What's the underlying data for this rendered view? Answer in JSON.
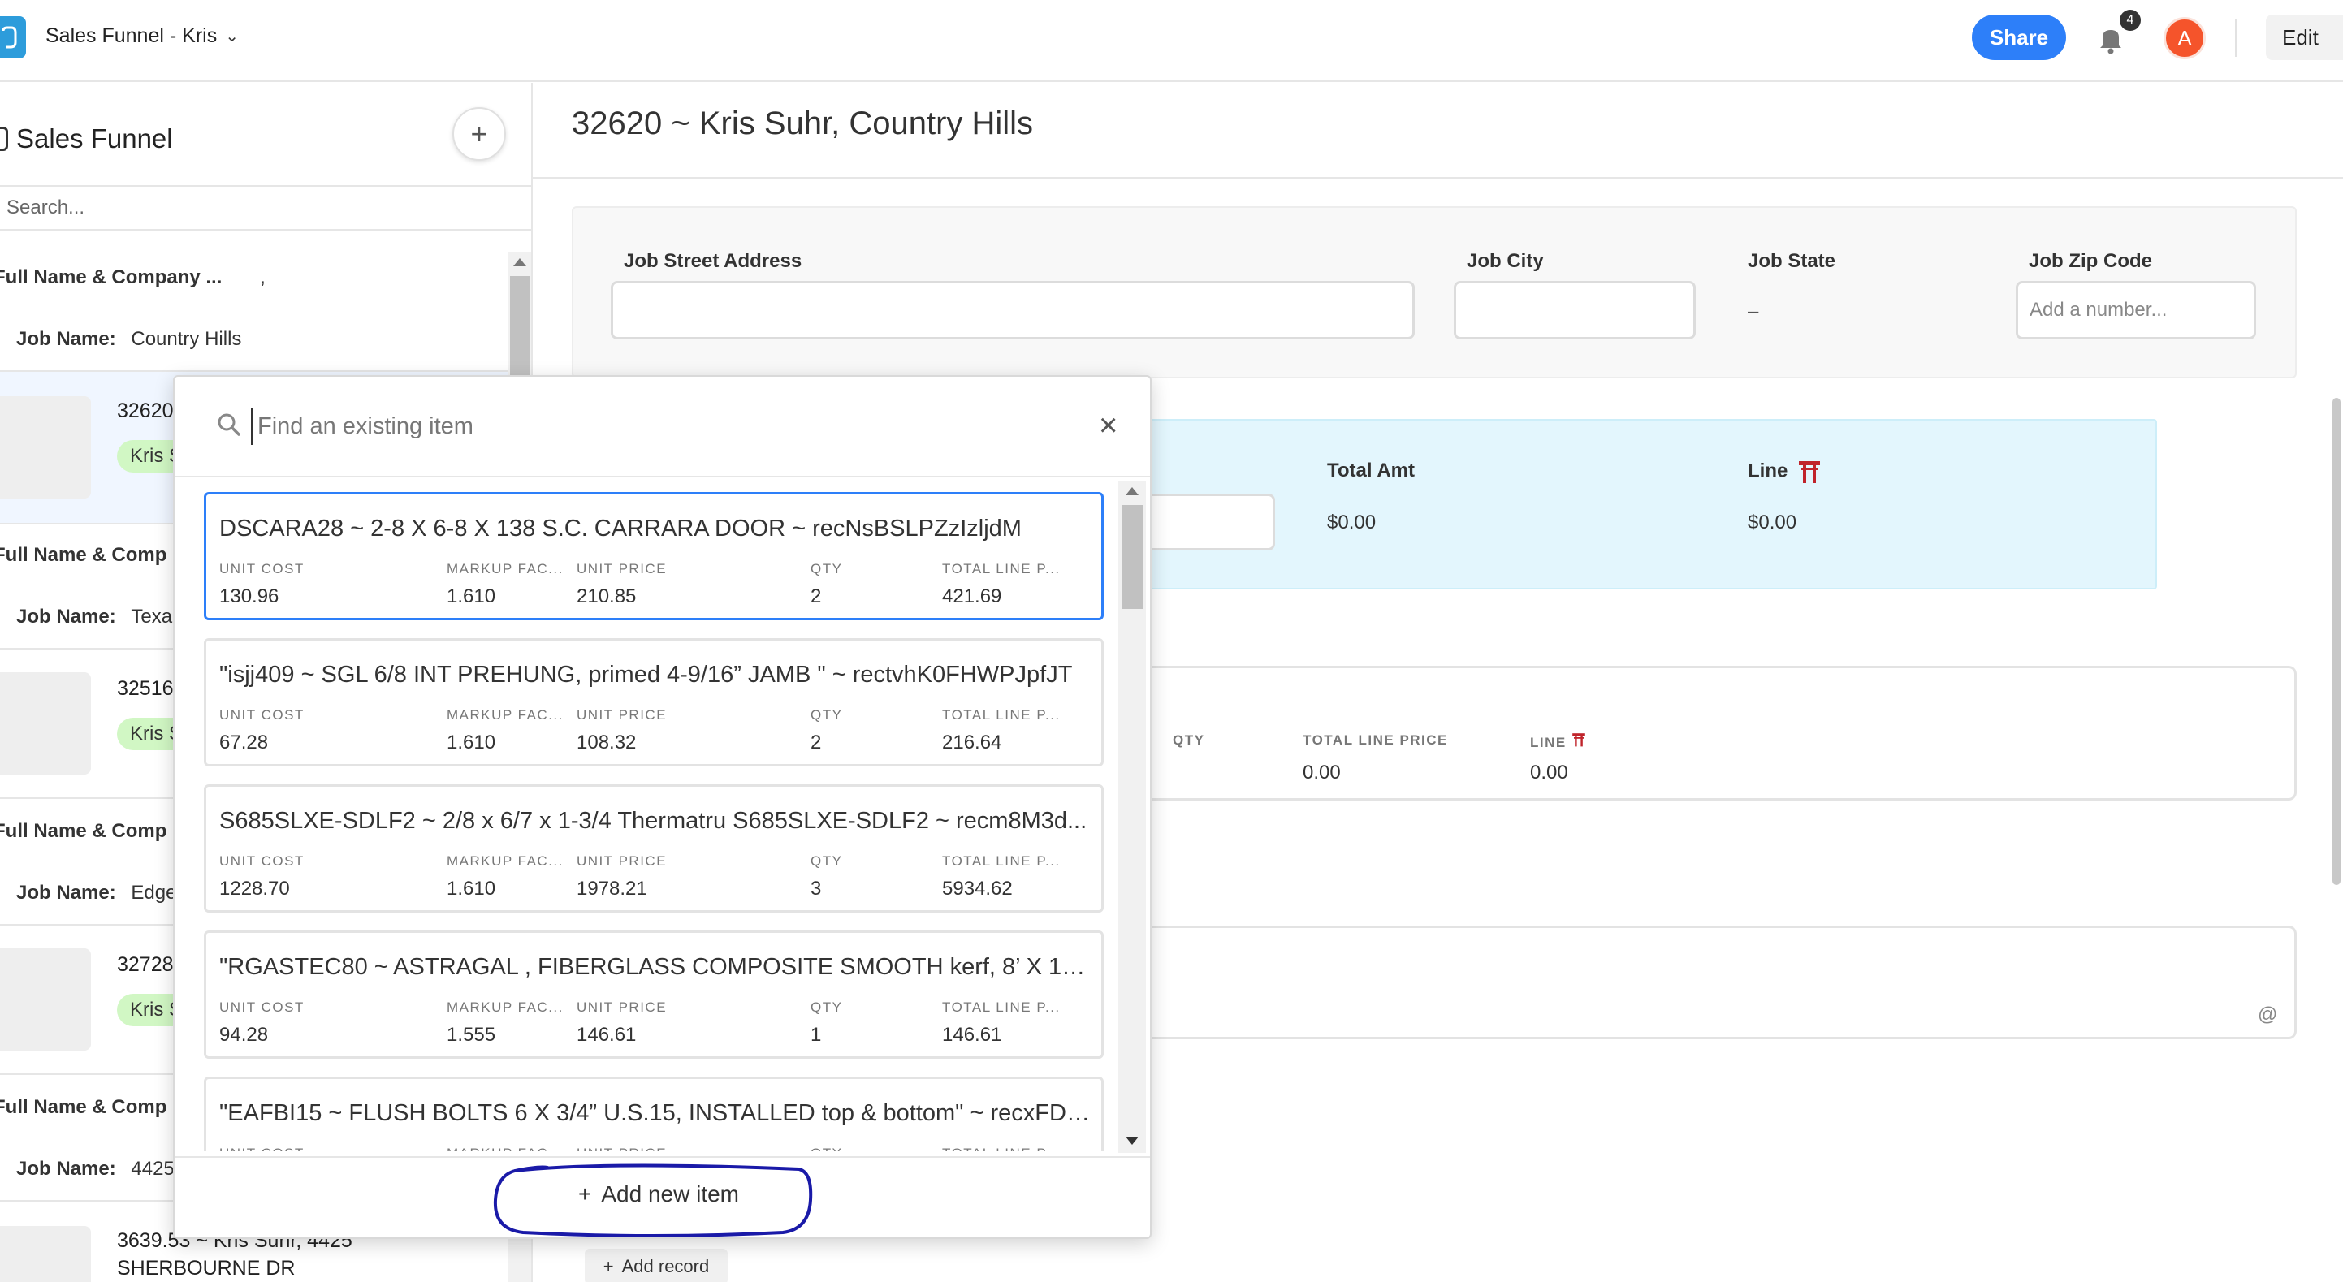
{
  "topbar": {
    "base_name": "Sales Funnel - Kris",
    "share_label": "Share",
    "notification_count": "4",
    "avatar_initial": "A",
    "edit_label": "Edit"
  },
  "sidebar": {
    "title": "Sales Funnel",
    "add_label": "+",
    "search_placeholder": "Search...",
    "records": [
      {
        "name_label": "Full Name & Company ...",
        "name_value": ",",
        "job_label": "Job Name:",
        "job_value": "Country Hills"
      },
      {
        "number": "32620",
        "tag": "Kris S",
        "selected": true
      },
      {
        "name_label": "Full Name & Comp",
        "job_label": "Job Name:",
        "job_value": "Texa"
      },
      {
        "number": "32516",
        "tag": "Kris S"
      },
      {
        "name_label": "Full Name & Comp",
        "job_label": "Job Name:",
        "job_value": "Edge"
      },
      {
        "number": "32728",
        "tag": "Kris S"
      },
      {
        "name_label": "Full Name & Comp",
        "job_label": "Job Name:",
        "job_value": "4425"
      },
      {
        "number": "3639.53 ~ Kris Suhr, 4425",
        "line2": "SHERBOURNE DR"
      }
    ]
  },
  "main": {
    "title": "32620 ~ Kris Suhr, Country Hills",
    "fields": {
      "street_label": "Job Street Address",
      "city_label": "Job City",
      "state_label": "Job State",
      "state_value": "–",
      "zip_label": "Job Zip Code",
      "zip_placeholder": "Add a number..."
    },
    "totals": {
      "total_amt_label": "Total Amt",
      "total_amt_value": "$0.00",
      "line_label": "Line",
      "line_value": "$0.00"
    },
    "items_panel": {
      "qty_header": "QTY",
      "total_line_header": "TOTAL LINE PRICE",
      "line_header": "LINE",
      "total_line_value": "0.00",
      "line_value": "0.00"
    },
    "notes_icon": "@",
    "add_record_label": "Add record"
  },
  "picker": {
    "search_placeholder": "Find an existing item",
    "close_label": "×",
    "column_headers": [
      "UNIT COST",
      "MARKUP FAC...",
      "UNIT PRICE",
      "QTY",
      "TOTAL LINE P..."
    ],
    "items": [
      {
        "title": "DSCARA28 ~ 2-8 X 6-8 X 138 S.C. CARRARA DOOR ~ recNsBSLPZzIzljdM",
        "unit_cost": "130.96",
        "markup": "1.610",
        "unit_price": "210.85",
        "qty": "2",
        "total": "421.69"
      },
      {
        "title": "\"isjj409 ~ SGL 6/8 INT PREHUNG, primed 4-9/16” JAMB \" ~ rectvhK0FHWPJpfJT",
        "unit_cost": "67.28",
        "markup": "1.610",
        "unit_price": "108.32",
        "qty": "2",
        "total": "216.64"
      },
      {
        "title": "S685SLXE-SDLF2 ~ 2/8 x 6/7 x 1-3/4 Thermatru S685SLXE-SDLF2 ~ recm8M3d...",
        "unit_cost": "1228.70",
        "markup": "1.610",
        "unit_price": "1978.21",
        "qty": "3",
        "total": "5934.62"
      },
      {
        "title": "\"RGASTEC80 ~ ASTRAGAL , FIBERGLASS COMPOSITE SMOOTH kerf, 8’ X 134 \" ...",
        "unit_cost": "94.28",
        "markup": "1.555",
        "unit_price": "146.61",
        "qty": "1",
        "total": "146.61"
      },
      {
        "title": "\"EAFBI15 ~ FLUSH BOLTS 6 X 3/4” U.S.15, INSTALLED top & bottom\" ~ recxFDZ...",
        "unit_cost": "",
        "markup": "",
        "unit_price": "",
        "qty": "",
        "total": ""
      }
    ],
    "add_new_label": "Add new item"
  },
  "colors": {
    "accent": "#2d7ff9",
    "tag_green": "#d1f7c4",
    "totals_bg": "#e3f6fd",
    "avatar": "#f5542b",
    "annotation_ink": "#1a1aa8"
  },
  "icons": {
    "logo": "app-logo-icon",
    "bell": "bell-icon",
    "search": "search-icon",
    "close": "close-icon",
    "plus": "plus-icon",
    "torii": "torii-gate-icon"
  }
}
